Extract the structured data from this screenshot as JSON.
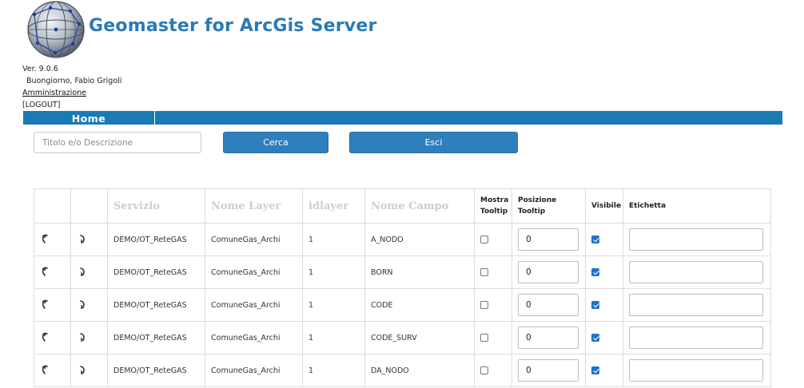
{
  "app": {
    "title": "Geomaster for ArcGis Server"
  },
  "meta": {
    "version": "Ver. 9.0.6",
    "user": "Buongiorno, Fabio Grigoli",
    "admin_link": "Amministrazione",
    "logout": "[LOGOUT]"
  },
  "nav": {
    "home": "Home"
  },
  "search": {
    "placeholder": "Titolo e/o Descrizione",
    "value": ""
  },
  "buttons": {
    "search": "Cerca",
    "exit": "Esci"
  },
  "table": {
    "headers": {
      "servizio": "Servizio",
      "nome_layer": "Nome Layer",
      "idlayer": "idlayer",
      "nome_campo": "Nome Campo",
      "mostra_tooltip": "Mostra Tooltip",
      "posizione_tooltip": "Posizione Tooltip",
      "visibile": "Visibile",
      "etichetta": "Etichetta"
    },
    "rows": [
      {
        "servizio": "DEMO/OT_ReteGAS",
        "nome_layer": "ComuneGas_Archi",
        "idlayer": "1",
        "nome_campo": "A_NODO",
        "mostra_tooltip": false,
        "posizione_tooltip": "0",
        "visibile": true,
        "etichetta": ""
      },
      {
        "servizio": "DEMO/OT_ReteGAS",
        "nome_layer": "ComuneGas_Archi",
        "idlayer": "1",
        "nome_campo": "BORN",
        "mostra_tooltip": false,
        "posizione_tooltip": "0",
        "visibile": true,
        "etichetta": ""
      },
      {
        "servizio": "DEMO/OT_ReteGAS",
        "nome_layer": "ComuneGas_Archi",
        "idlayer": "1",
        "nome_campo": "CODE",
        "mostra_tooltip": false,
        "posizione_tooltip": "0",
        "visibile": true,
        "etichetta": ""
      },
      {
        "servizio": "DEMO/OT_ReteGAS",
        "nome_layer": "ComuneGas_Archi",
        "idlayer": "1",
        "nome_campo": "CODE_SURV",
        "mostra_tooltip": false,
        "posizione_tooltip": "0",
        "visibile": true,
        "etichetta": ""
      },
      {
        "servizio": "DEMO/OT_ReteGAS",
        "nome_layer": "ComuneGas_Archi",
        "idlayer": "1",
        "nome_campo": "DA_NODO",
        "mostra_tooltip": false,
        "posizione_tooltip": "0",
        "visibile": true,
        "etichetta": ""
      }
    ]
  },
  "icons": {
    "logo": "globe-logo-icon",
    "row_undo": "undo-icon",
    "row_redo": "redo-icon"
  },
  "colors": {
    "brand": "#2a7ab8",
    "nav": "#1a7ab4",
    "button": "#2f7fbd",
    "checkbox_checked": "#1f73c8"
  }
}
